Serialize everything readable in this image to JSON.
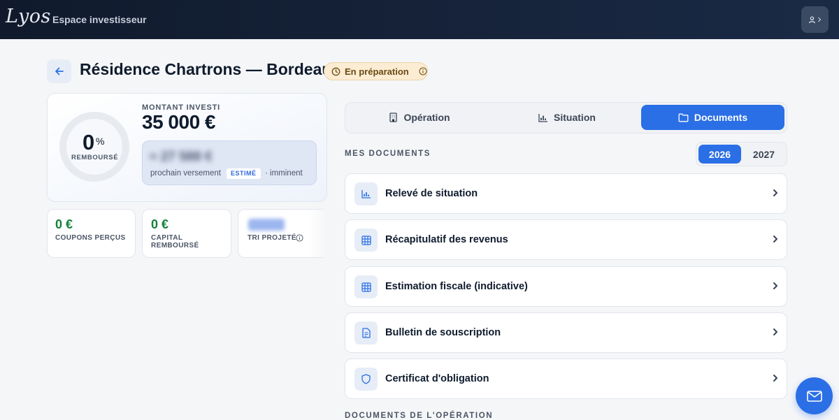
{
  "header": {
    "logo_text": "Lyos",
    "space_label": "Espace investisseur"
  },
  "page": {
    "title": "Résidence Chartrons — Bordeaux",
    "status": "En préparation"
  },
  "summary": {
    "ring_value": "0",
    "ring_unit": "%",
    "ring_label": "REMBOURSÉ",
    "ring_progress": 0,
    "invested_label": "MONTANT INVESTI",
    "invested_value": "35 000 €",
    "next_payment_amount_masked": "≈ 27 588 €",
    "next_payment_label": "prochain versement",
    "next_payment_badge": "ESTIMÉ",
    "next_payment_timing": "· imminent"
  },
  "stats": [
    {
      "value": "0 €",
      "label": "COUPONS PERÇUS"
    },
    {
      "value": "0 €",
      "label_line1": "CAPITAL",
      "label_line2": "REMBOURSÉ"
    },
    {
      "value_masked": "██%",
      "label": "TRI PROJETÉ"
    }
  ],
  "tabs": [
    {
      "label": "Opération",
      "icon": "building-icon",
      "active": false
    },
    {
      "label": "Situation",
      "icon": "bar-chart-icon",
      "active": false
    },
    {
      "label": "Documents",
      "icon": "folder-icon",
      "active": true
    }
  ],
  "documents_section": {
    "title": "MES DOCUMENTS",
    "years": [
      "2026",
      "2027"
    ],
    "selected_year": "2026",
    "items": [
      {
        "label": "Relevé de situation",
        "icon": "chart-icon"
      },
      {
        "label": "Récapitulatif des revenus",
        "icon": "table-icon"
      },
      {
        "label": "Estimation fiscale (indicative)",
        "icon": "table-icon"
      },
      {
        "label": "Bulletin de souscription",
        "icon": "document-icon"
      },
      {
        "label": "Certificat d'obligation",
        "icon": "shield-icon"
      }
    ]
  },
  "operation_documents_section": {
    "title": "DOCUMENTS DE L'OPÉRATION"
  },
  "colors": {
    "accent": "#2b6fe6",
    "topbar": "#101a2c",
    "positive": "#15803d",
    "status_bg": "#fbecd3"
  }
}
